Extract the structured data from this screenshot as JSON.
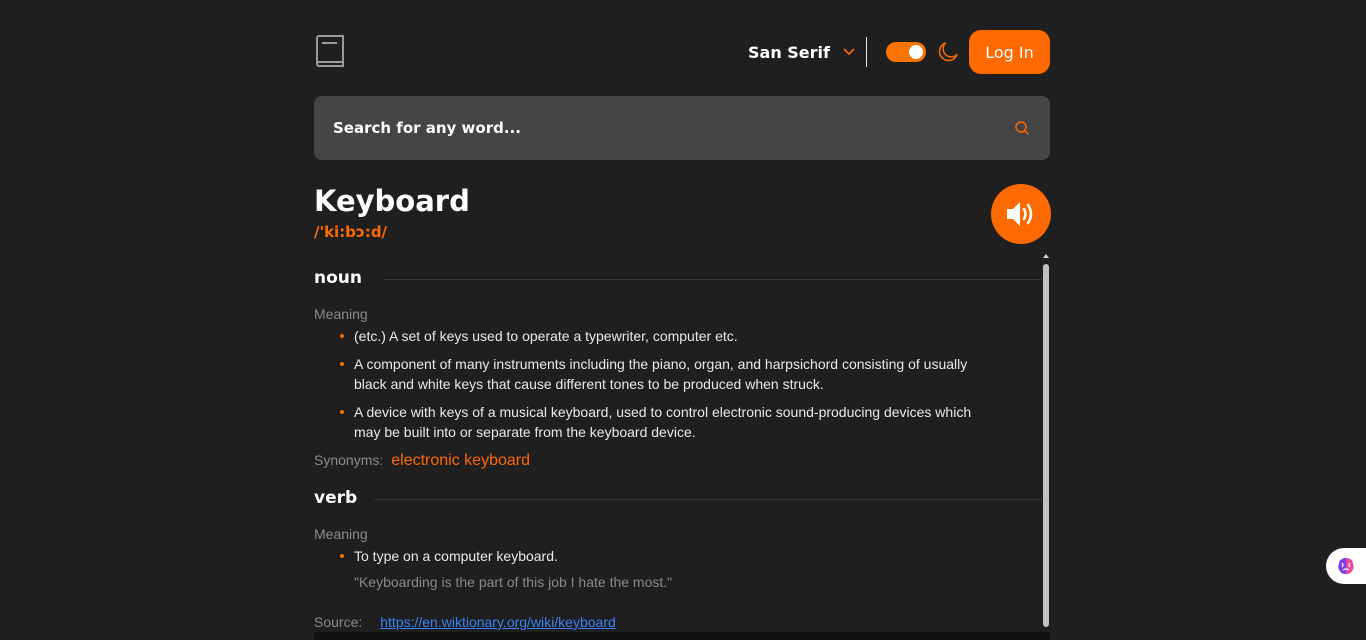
{
  "header": {
    "font_selector": {
      "value": "San Serif"
    },
    "login_label": "Log In"
  },
  "search": {
    "placeholder": "Search for any word..."
  },
  "entry": {
    "word": "Keyboard",
    "phonetic": "/'ki:bↄ:d/",
    "meanings": [
      {
        "part_of_speech": "noun",
        "meaning_label": "Meaning",
        "definitions": [
          "(etc.) A set of keys used to operate a typewriter, computer etc.",
          "A component of many instruments including the piano, organ, and harpsichord consisting of usually black and white keys that cause different tones to be produced when struck.",
          "A device with keys of a musical keyboard, used to control electronic sound-producing devices which may be built into or separate from the keyboard device."
        ],
        "synonyms_label": "Synonyms:",
        "synonyms": [
          "electronic keyboard"
        ]
      },
      {
        "part_of_speech": "verb",
        "meaning_label": "Meaning",
        "definitions": [
          "To type on a computer keyboard."
        ],
        "example": "\"Keyboarding is the part of this job I hate the most.\""
      }
    ],
    "source_label": "Source:",
    "source_url": "https://en.wiktionary.org/wiki/keyboard"
  },
  "theme": {
    "accent": "#ff6a00",
    "background": "#1f1f1f",
    "search_bg": "#454545",
    "link": "#3b82f6",
    "dark_mode": true
  },
  "icons": {
    "logo": "book-icon",
    "dropdown": "chevron-down-icon",
    "theme": "moon-icon",
    "search": "search-icon",
    "play": "speaker-icon",
    "widget": "brain-icon"
  }
}
